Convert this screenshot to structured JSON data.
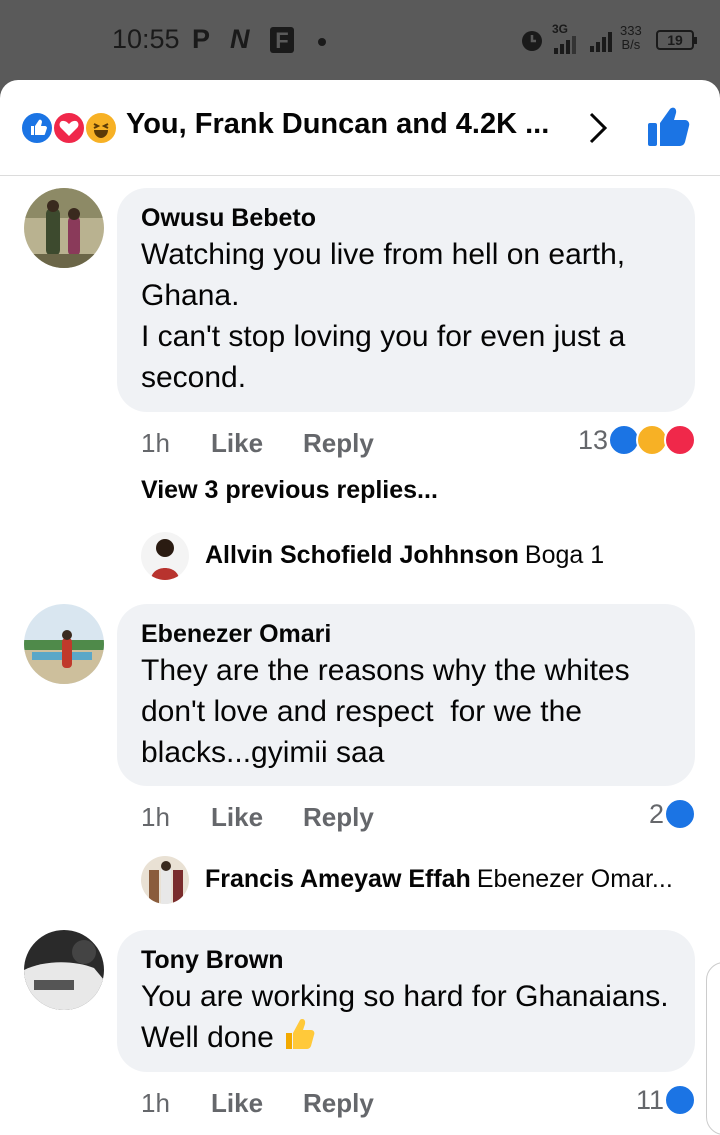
{
  "status_bar": {
    "time": "10:55",
    "left_icons": [
      "P",
      "N",
      "F"
    ],
    "network": "3G",
    "net_speed_value": "333",
    "net_speed_unit": "B/s",
    "battery": "19"
  },
  "header": {
    "reaction_icons": [
      "like-icon",
      "love-icon",
      "haha-icon"
    ],
    "reactors_text": "You, Frank Duncan and 4.2K ..."
  },
  "comments": [
    {
      "author": "Owusu Bebeto",
      "text": "Watching you live from hell on earth, Ghana.\nI can't stop loving you for even just a second.",
      "time": "1h",
      "like_label": "Like",
      "reply_label": "Reply",
      "reaction_count": "13",
      "reactions": [
        "like",
        "haha",
        "love"
      ],
      "view_previous": "View 3 previous replies...",
      "reply": {
        "author": "Allvin Schofield Johhnson",
        "text": "Boga 1"
      }
    },
    {
      "author": "Ebenezer Omari",
      "text": "They are the reasons why the whites don't love and respect  for we the blacks...gyimii saa",
      "time": "1h",
      "like_label": "Like",
      "reply_label": "Reply",
      "reaction_count": "2",
      "reactions": [
        "like"
      ],
      "reply": {
        "author": "Francis Ameyaw Effah",
        "text": "Ebenezer Omar..."
      }
    },
    {
      "author": "Tony Brown",
      "text": "You are working so hard for Ghanaians. Well done",
      "time": "1h",
      "like_label": "Like",
      "reply_label": "Reply",
      "reaction_count": "11",
      "reactions": [
        "like"
      ]
    }
  ],
  "colors": {
    "accent": "#1b74e4",
    "love": "#f0284a",
    "haha": "#f7b125",
    "bubble": "#f0f2f5",
    "secondary_text": "#65676b"
  }
}
